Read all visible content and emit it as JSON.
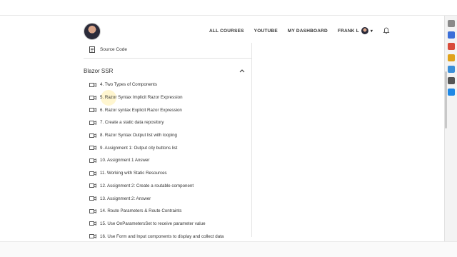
{
  "header": {
    "nav": [
      {
        "label": "ALL COURSES"
      },
      {
        "label": "YOUTUBE"
      },
      {
        "label": "MY DASHBOARD"
      }
    ],
    "user_name": "FRANK L",
    "icons": [
      "avatar",
      "user-avatar",
      "chevron-down-icon",
      "bell-icon"
    ]
  },
  "resource": {
    "label": "Source Code",
    "icon": "document-icon"
  },
  "section": {
    "title": "Blazor SSR",
    "icon": "chevron-up-icon",
    "lessons": [
      {
        "label": "4. Two Types of Components"
      },
      {
        "label": "5. Razor Syntax Implicit Razor Expression"
      },
      {
        "label": "6. Razor syntax Explicit Razor Expression"
      },
      {
        "label": "7. Create a static data repository"
      },
      {
        "label": "8. Razor Syntax Output list with looping"
      },
      {
        "label": "9. Assignment 1: Output city buttons list"
      },
      {
        "label": "10. Assignment 1 Answer"
      },
      {
        "label": "11. Working with Static Resources"
      },
      {
        "label": "12. Assignment 2: Create a routable component"
      },
      {
        "label": "13. Assignment 2: Answer"
      },
      {
        "label": "14. Route Parameters & Route Contraints"
      },
      {
        "label": "15. Use OnParametersSet to receive parameter value"
      },
      {
        "label": "16. Use Form and Input components to display and collect data"
      }
    ]
  },
  "colors": {
    "text": "#333333",
    "divider": "#e0e0e0",
    "background": "#ffffff"
  }
}
